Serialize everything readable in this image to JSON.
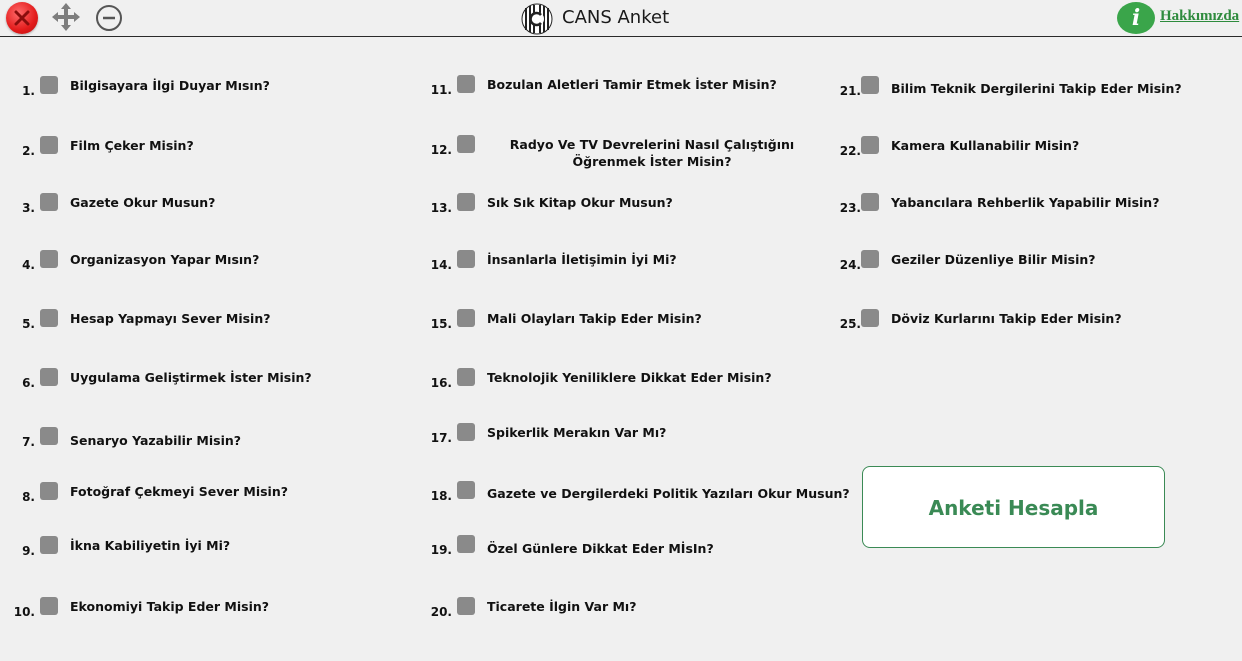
{
  "window": {
    "title": "CANS Anket",
    "about_label": "Hakkımızda",
    "accent_color": "#2e8b3d",
    "close_color": "#e31b1b"
  },
  "questions": [
    {
      "num": "1.",
      "text": "Bilgisayara İlgi Duyar Mısın?",
      "checked": false
    },
    {
      "num": "2.",
      "text": "Film Çeker Misin?",
      "checked": false
    },
    {
      "num": "3.",
      "text": "Gazete Okur Musun?",
      "checked": false
    },
    {
      "num": "4.",
      "text": "Organizasyon Yapar Mısın?",
      "checked": false
    },
    {
      "num": "5.",
      "text": "Hesap Yapmayı Sever Misin?",
      "checked": false
    },
    {
      "num": "6.",
      "text": "Uygulama Geliştirmek İster Misin?",
      "checked": false
    },
    {
      "num": "7.",
      "text": "Senaryo Yazabilir Misin?",
      "checked": false
    },
    {
      "num": "8.",
      "text": "Fotoğraf Çekmeyi Sever Misin?",
      "checked": false
    },
    {
      "num": "9.",
      "text": "İkna Kabiliyetin İyi Mi?",
      "checked": false
    },
    {
      "num": "10.",
      "text": "Ekonomiyi Takip Eder Misin?",
      "checked": false
    },
    {
      "num": "11.",
      "text": "Bozulan Aletleri Tamir Etmek İster Misin?",
      "checked": false
    },
    {
      "num": "12.",
      "text": "Radyo Ve TV Devrelerini Nasıl Çalıştığını Öğrenmek İster Misin?",
      "checked": false
    },
    {
      "num": "13.",
      "text": "Sık Sık Kitap Okur Musun?",
      "checked": false
    },
    {
      "num": "14.",
      "text": "İnsanlarla İletişimin İyi Mi?",
      "checked": false
    },
    {
      "num": "15.",
      "text": "Mali Olayları Takip Eder Misin?",
      "checked": false
    },
    {
      "num": "16.",
      "text": "Teknolojik Yeniliklere Dikkat Eder Misin?",
      "checked": false
    },
    {
      "num": "17.",
      "text": "Spikerlik Merakın Var Mı?",
      "checked": false
    },
    {
      "num": "18.",
      "text": "Gazete ve Dergilerdeki Politik Yazıları Okur Musun?",
      "checked": false
    },
    {
      "num": "19.",
      "text": "Özel Günlere Dikkat Eder MİsIn?",
      "checked": false
    },
    {
      "num": "20.",
      "text": "Ticarete İlgin Var Mı?",
      "checked": false
    },
    {
      "num": "21.",
      "text": "Bilim Teknik Dergilerini Takip Eder Misin?",
      "checked": false
    },
    {
      "num": "22.",
      "text": "Kamera Kullanabilir Misin?",
      "checked": false
    },
    {
      "num": "23.",
      "text": "Yabancılara Rehberlik Yapabilir Misin?",
      "checked": false
    },
    {
      "num": "24.",
      "text": "Geziler Düzenliye Bilir Misin?",
      "checked": false
    },
    {
      "num": "25.",
      "text": "Döviz Kurlarını Takip Eder Misin?",
      "checked": false
    }
  ],
  "calculate_button": "Anketi Hesapla"
}
